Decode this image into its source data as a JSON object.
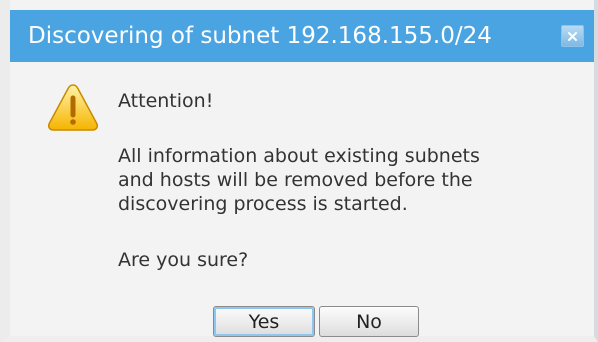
{
  "dialog": {
    "title": "Discovering of subnet 192.168.155.0/24",
    "close_icon": "close-icon",
    "warning_icon": "warning-icon",
    "attention": "Attention!",
    "message": "All information about existing subnets\nand hosts will be removed before the\ndiscovering process is started.",
    "question": "Are you sure?",
    "buttons": {
      "yes_label": "Yes",
      "no_label": "No"
    }
  },
  "colors": {
    "titlebar": "#4aa4e2",
    "dialog_background": "#f3f3f3",
    "focus_ring": "#8fc6ee"
  }
}
